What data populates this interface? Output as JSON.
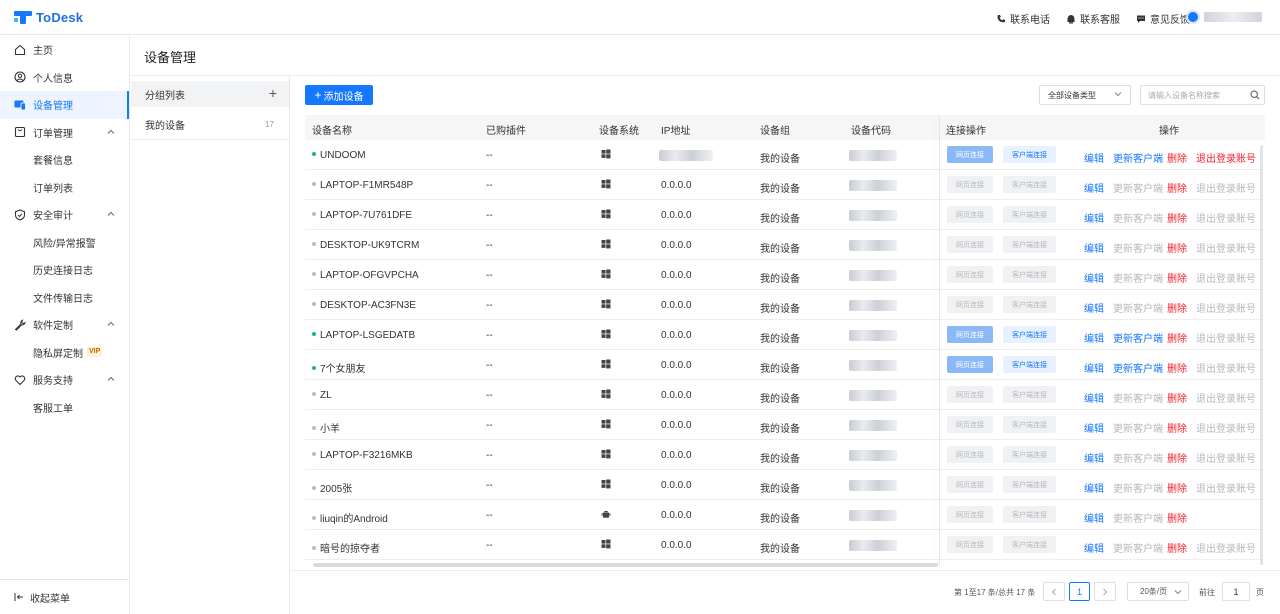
{
  "app": {
    "name": "ToDesk"
  },
  "header": {
    "phone": "联系电话",
    "service": "联系客服",
    "feedback": "意见反馈"
  },
  "sidebar": {
    "home": "主页",
    "profile": "个人信息",
    "devices": "设备管理",
    "orders": "订单管理",
    "package_info": "套餐信息",
    "order_list": "订单列表",
    "security": "安全审计",
    "risk_alert": "风险/异常报警",
    "history_log": "历史连接日志",
    "file_log": "文件传输日志",
    "software": "软件定制",
    "privacy_screen": "隐私屏定制",
    "vip": "VIP",
    "support": "服务支持",
    "ticket": "客服工单",
    "collapse": "收起菜单"
  },
  "page": {
    "title": "设备管理"
  },
  "groups": {
    "header": "分组列表",
    "items": [
      {
        "label": "我的设备",
        "count": "17"
      }
    ]
  },
  "toolbar": {
    "add": "添加设备",
    "type_filter": "全部设备类型",
    "search_placeholder": "请输入设备名称搜索"
  },
  "table": {
    "columns": {
      "name": "设备名称",
      "plugin": "已购插件",
      "os": "设备系统",
      "ip": "IP地址",
      "group": "设备组",
      "code": "设备代码",
      "connect": "连接操作",
      "ops": "操作"
    },
    "labels": {
      "web_connect": "网页连接",
      "client_connect": "客户端连接",
      "edit": "编辑",
      "update_client": "更新客户端",
      "delete": "删除",
      "logout": "退出登录账号"
    },
    "rows": [
      {
        "name": "UNDOOM",
        "plugin": "--",
        "os": "windows",
        "ip": "",
        "group": "我的设备",
        "online": true,
        "logout": true
      },
      {
        "name": "LAPTOP-F1MR548P",
        "plugin": "--",
        "os": "windows",
        "ip": "0.0.0.0",
        "group": "我的设备",
        "online": false,
        "logout": true
      },
      {
        "name": "LAPTOP-7U761DFE",
        "plugin": "--",
        "os": "windows",
        "ip": "0.0.0.0",
        "group": "我的设备",
        "online": false,
        "logout": true
      },
      {
        "name": "DESKTOP-UK9TCRM",
        "plugin": "--",
        "os": "windows",
        "ip": "0.0.0.0",
        "group": "我的设备",
        "online": false,
        "logout": true
      },
      {
        "name": "LAPTOP-OFGVPCHA",
        "plugin": "--",
        "os": "windows",
        "ip": "0.0.0.0",
        "group": "我的设备",
        "online": false,
        "logout": true
      },
      {
        "name": "DESKTOP-AC3FN3E",
        "plugin": "--",
        "os": "windows",
        "ip": "0.0.0.0",
        "group": "我的设备",
        "online": false,
        "logout": true
      },
      {
        "name": "LAPTOP-LSGEDATB",
        "plugin": "--",
        "os": "windows",
        "ip": "0.0.0.0",
        "group": "我的设备",
        "online": true,
        "logout": true
      },
      {
        "name": "7个女朋友",
        "plugin": "--",
        "os": "windows",
        "ip": "0.0.0.0",
        "group": "我的设备",
        "online": true,
        "logout": true
      },
      {
        "name": "ZL",
        "plugin": "--",
        "os": "windows",
        "ip": "0.0.0.0",
        "group": "我的设备",
        "online": false,
        "logout": true
      },
      {
        "name": "小羊",
        "plugin": "--",
        "os": "windows",
        "ip": "0.0.0.0",
        "group": "我的设备",
        "online": false,
        "logout": true
      },
      {
        "name": "LAPTOP-F3216MKB",
        "plugin": "--",
        "os": "windows",
        "ip": "0.0.0.0",
        "group": "我的设备",
        "online": false,
        "logout": true
      },
      {
        "name": "2005张",
        "plugin": "--",
        "os": "windows",
        "ip": "0.0.0.0",
        "group": "我的设备",
        "online": false,
        "logout": true
      },
      {
        "name": "liuqin的Android",
        "plugin": "--",
        "os": "android",
        "ip": "0.0.0.0",
        "group": "我的设备",
        "online": false,
        "logout": false
      },
      {
        "name": "暗号的掠夺者",
        "plugin": "--",
        "os": "windows",
        "ip": "0.0.0.0",
        "group": "我的设备",
        "online": false,
        "logout": true
      }
    ]
  },
  "pagination": {
    "info": "第 1至17 条/总共 17 条",
    "current_page": "1",
    "page_size": "20条/页",
    "goto_label": "前往",
    "goto_value": "1",
    "page_unit": "页"
  },
  "colors": {
    "primary": "#1677ff",
    "danger": "#f5222d",
    "online": "#19be6b",
    "offline": "#b8bbc0"
  }
}
